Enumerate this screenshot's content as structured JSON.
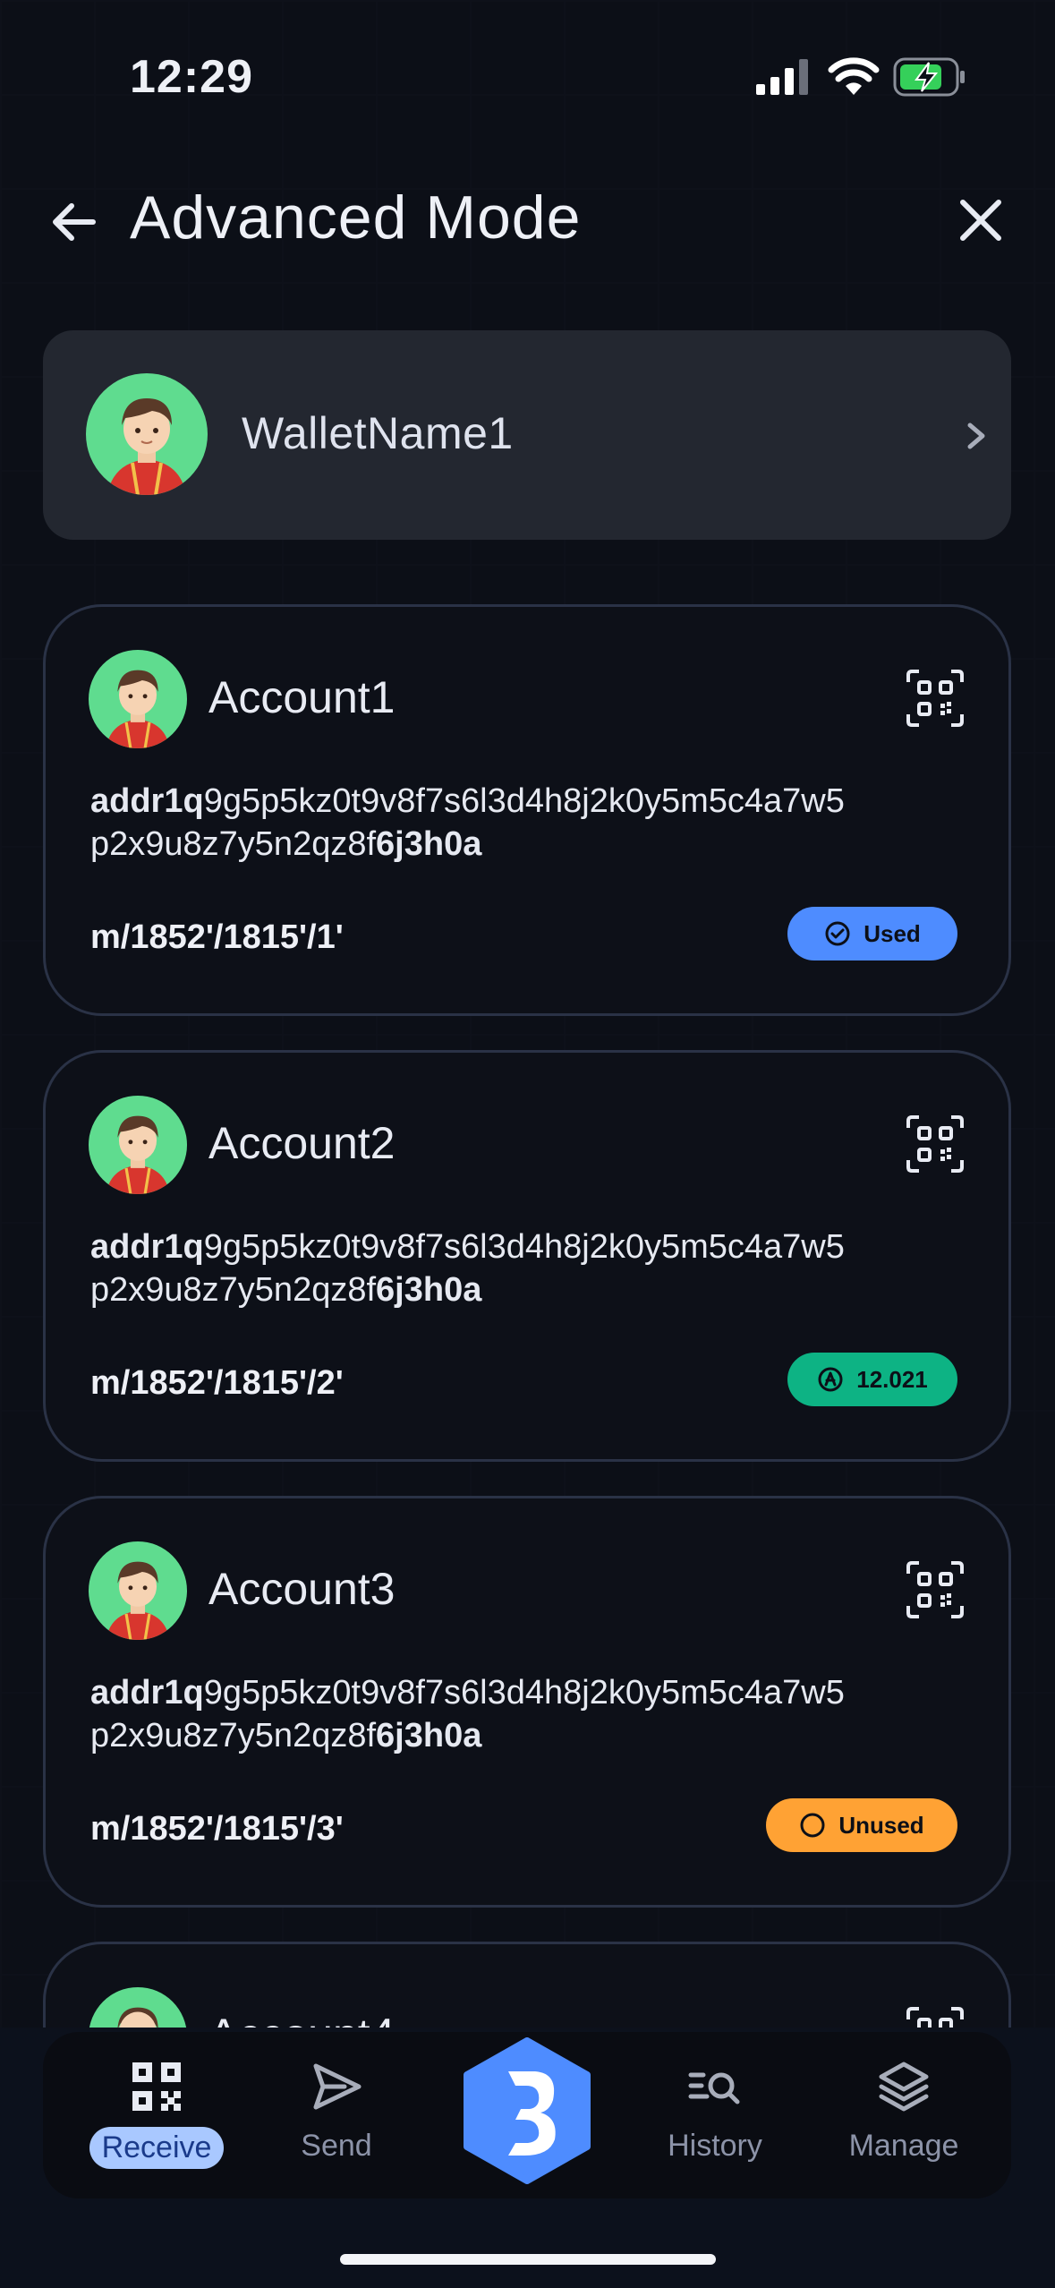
{
  "status_bar": {
    "time": "12:29"
  },
  "header": {
    "title": "Advanced Mode"
  },
  "wallet": {
    "name": "WalletName1"
  },
  "accounts": [
    {
      "name": "Account1",
      "address_prefix": "addr1q",
      "address_middle": "9g5p5kz0t9v8f7s6l3d4h8j2k0y5m5c4a7w5p2x9u8z7y5n2qz8f",
      "address_suffix": "6j3h0a",
      "path": "m/1852'/1815'/1'",
      "badge": "Used"
    },
    {
      "name": "Account2",
      "address_prefix": "addr1q",
      "address_middle": "9g5p5kz0t9v8f7s6l3d4h8j2k0y5m5c4a7w5p2x9u8z7y5n2qz8f",
      "address_suffix": "6j3h0a",
      "path": "m/1852'/1815'/2'",
      "badge": "12.021"
    },
    {
      "name": "Account3",
      "address_prefix": "addr1q",
      "address_middle": "9g5p5kz0t9v8f7s6l3d4h8j2k0y5m5c4a7w5p2x9u8z7y5n2qz8f",
      "address_suffix": "6j3h0a",
      "path": "m/1852'/1815'/3'",
      "badge": "Unused"
    },
    {
      "name": "Account4"
    }
  ],
  "nav": {
    "receive": "Receive",
    "send": "Send",
    "history": "History",
    "manage": "Manage"
  },
  "colors": {
    "used": "#4e8cff",
    "balance": "#0db384",
    "unused": "#ffa234",
    "center_button": "#4e8cff"
  }
}
